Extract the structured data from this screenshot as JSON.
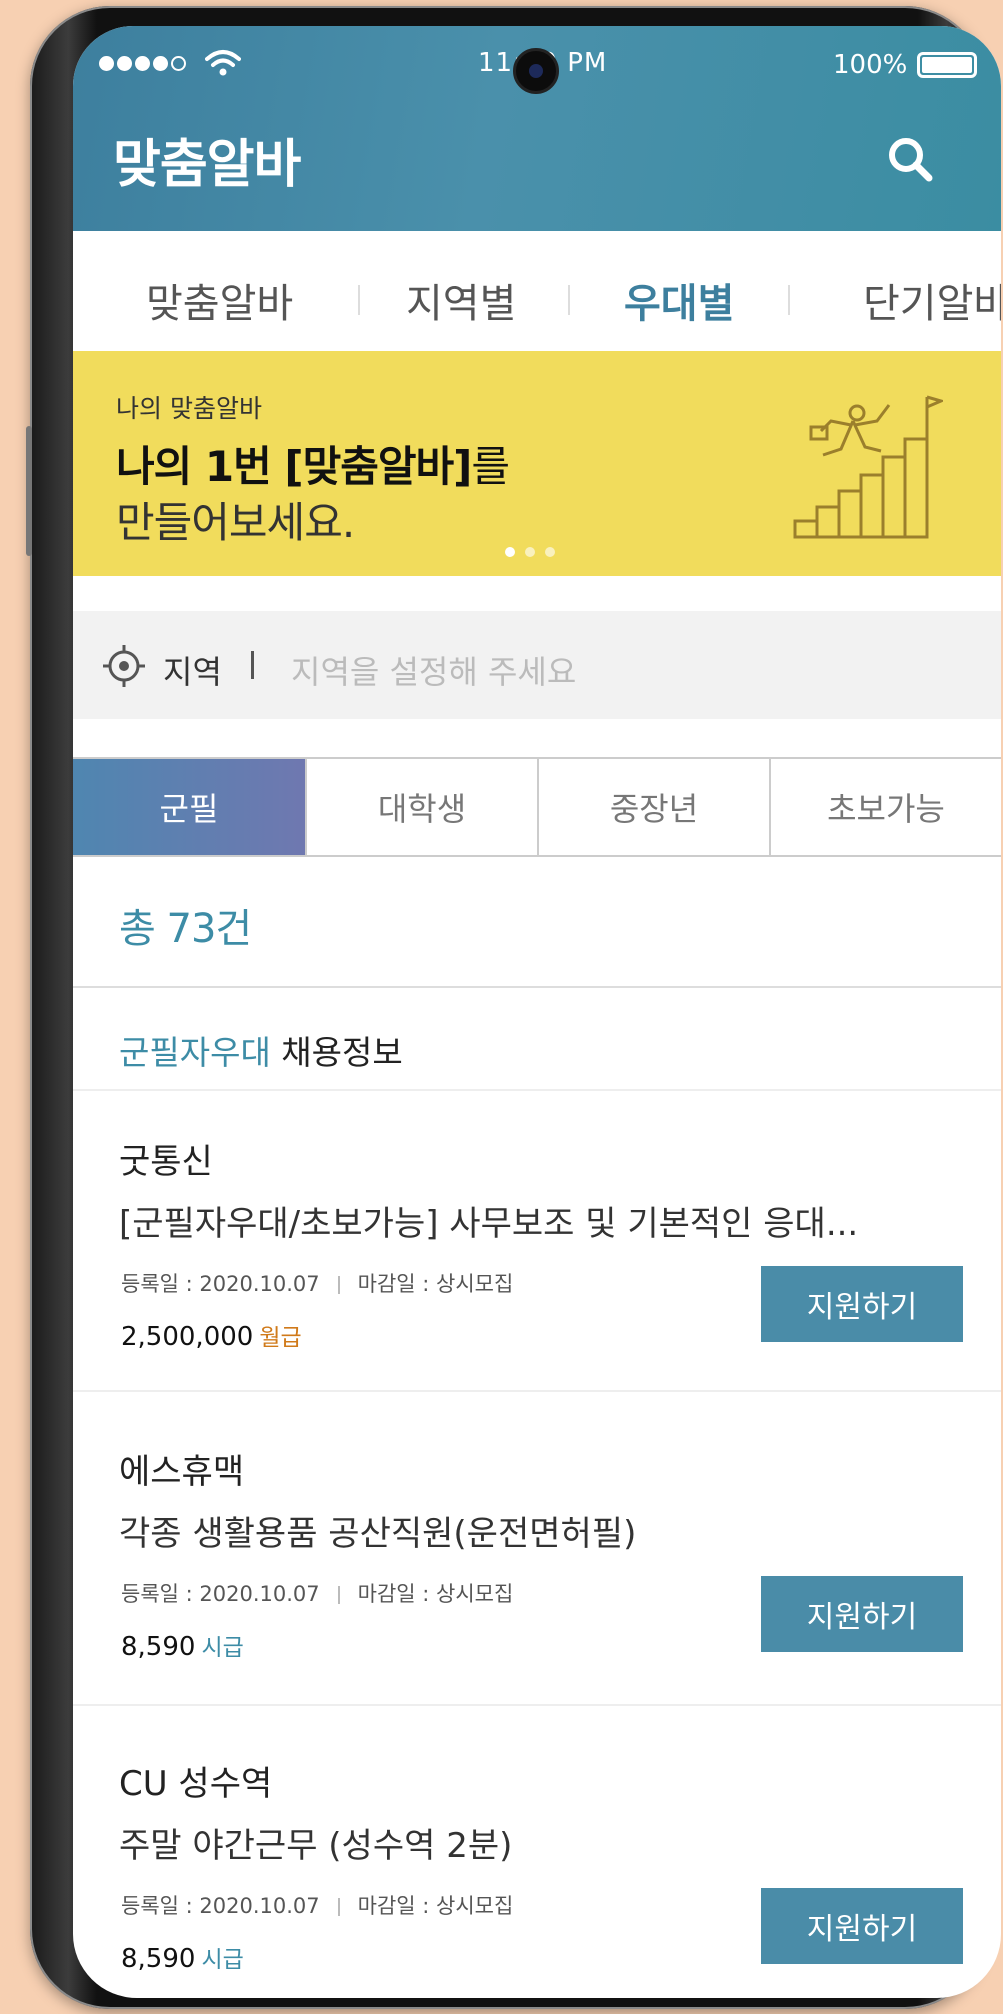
{
  "status_bar": {
    "time": "11:00 PM",
    "battery": "100%"
  },
  "header": {
    "title": "맞춤알바",
    "search_icon": "search-icon"
  },
  "top_tabs": [
    {
      "label": "맞춤알바",
      "active": false
    },
    {
      "label": "지역별",
      "active": false
    },
    {
      "label": "우대별",
      "active": true
    },
    {
      "label": "단기알바",
      "active": false
    }
  ],
  "banner": {
    "subtitle": "나의 맞춤알바",
    "line1_bold": "나의 1번 [맞춤알바]",
    "line1_rest": "를",
    "line2": "만들어보세요.",
    "illustration": "stairs-climber-icon",
    "page_count": 3,
    "current_page": 1
  },
  "region": {
    "icon": "target-icon",
    "label": "지역",
    "placeholder": "지역을 설정해 주세요"
  },
  "categories": [
    {
      "label": "군필",
      "active": true
    },
    {
      "label": "대학생",
      "active": false
    },
    {
      "label": "중장년",
      "active": false
    },
    {
      "label": "초보가능",
      "active": false
    }
  ],
  "summary": {
    "total": "총 73건"
  },
  "section": {
    "accent": "군필자우대",
    "title": " 채용정보"
  },
  "jobs": [
    {
      "company": "굿통신",
      "title": "[군필자우대/초보가능] 사무보조 및 기본적인 응대...",
      "registered": "등록일 : 2020.10.07",
      "deadline": "마감일 : 상시모집",
      "pay": "2,500,000",
      "pay_unit": "월급",
      "pay_unit_color": "#d07a1a",
      "apply_label": "지원하기"
    },
    {
      "company": "에스휴맥",
      "title": "각종 생활용품 공산직원(운전면허필)",
      "registered": "등록일 : 2020.10.07",
      "deadline": "마감일 : 상시모집",
      "pay": "8,590",
      "pay_unit": "시급",
      "pay_unit_color": "#3d8ca6",
      "apply_label": "지원하기"
    },
    {
      "company": "CU 성수역",
      "title": "주말 야간근무 (성수역 2분)",
      "registered": "등록일 : 2020.10.07",
      "deadline": "마감일 : 상시모집",
      "pay": "8,590",
      "pay_unit": "시급",
      "pay_unit_color": "#3d8ca6",
      "apply_label": "지원하기"
    }
  ],
  "colors": {
    "primary": "#4a8ca8",
    "banner": "#f1dc5c",
    "accent_text": "#3d8ca6"
  }
}
